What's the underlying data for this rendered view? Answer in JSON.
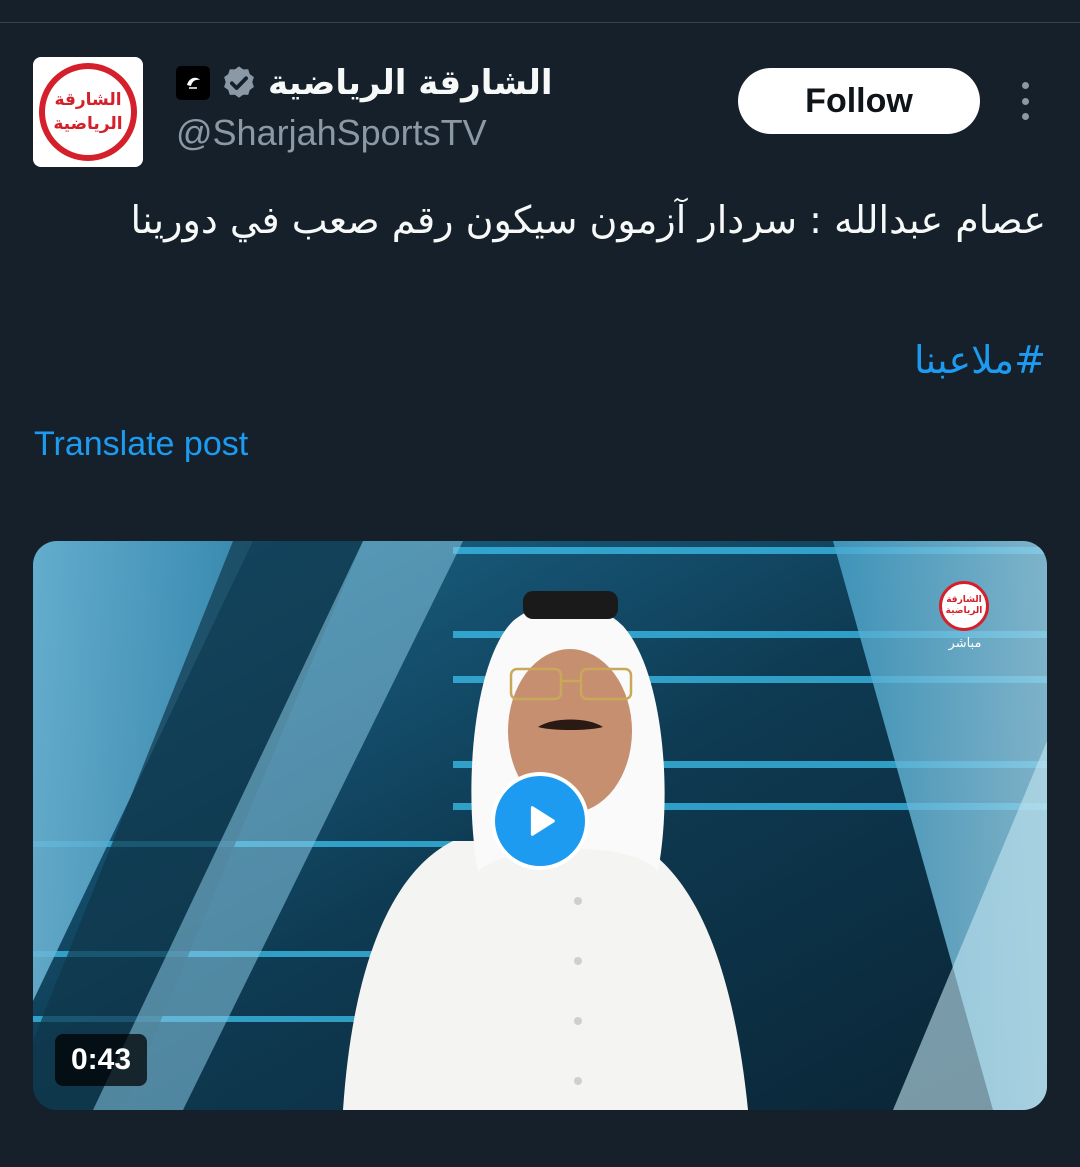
{
  "account": {
    "display_name": "الشارقة الرياضية",
    "handle": "@SharjahSportsTV",
    "avatar_text_line1": "الشارقة",
    "avatar_text_line2": "الرياضية",
    "verified_icon": "verified-badge-icon",
    "affiliate_icon": "channel-logo-icon"
  },
  "follow_button": {
    "label": "Follow"
  },
  "more_menu": {
    "icon": "more-vertical-icon"
  },
  "post": {
    "text": "عصام عبدالله : سردار آزمون سيكون رقم صعب في دورينا",
    "hashtag": "#ملاعبنا",
    "translate_label": "Translate post"
  },
  "video": {
    "duration": "0:43",
    "play_icon": "play-icon",
    "channel_logo_line1": "الشارقة",
    "channel_logo_line2": "الرياضية",
    "live_label": "مباشر"
  },
  "colors": {
    "background": "#15202b",
    "accent": "#1d9bf0",
    "text_primary": "#f7f9f9",
    "text_secondary": "#8b98a5",
    "brand_red": "#d4202b"
  }
}
